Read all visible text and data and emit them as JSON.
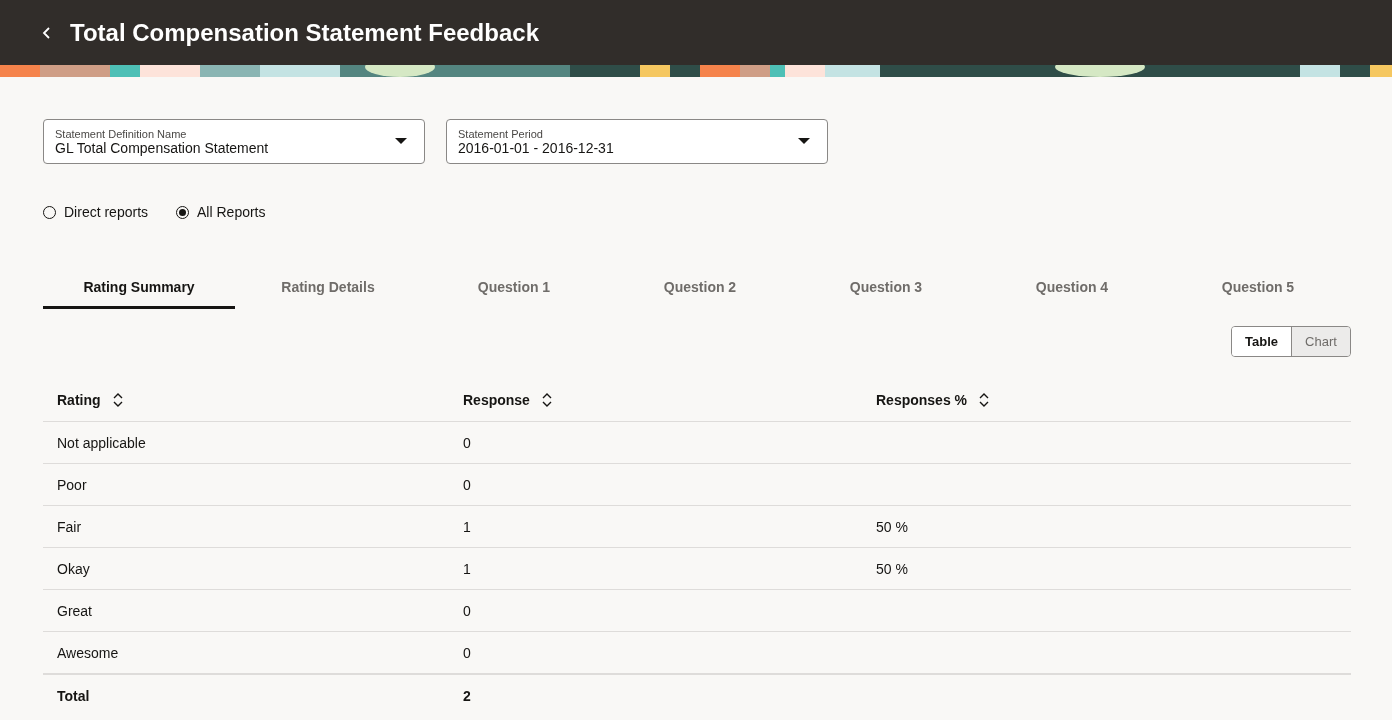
{
  "header": {
    "title": "Total Compensation Statement Feedback"
  },
  "filters": [
    {
      "label": "Statement Definition Name",
      "value": "GL Total Compensation Statement"
    },
    {
      "label": "Statement Period",
      "value": "2016-01-01 - 2016-12-31"
    }
  ],
  "report_scope": [
    {
      "label": "Direct reports",
      "selected": false
    },
    {
      "label": "All Reports",
      "selected": true
    }
  ],
  "tabs": [
    {
      "label": "Rating Summary",
      "selected": true
    },
    {
      "label": "Rating Details",
      "selected": false
    },
    {
      "label": "Question 1",
      "selected": false
    },
    {
      "label": "Question 2",
      "selected": false
    },
    {
      "label": "Question 3",
      "selected": false
    },
    {
      "label": "Question 4",
      "selected": false
    },
    {
      "label": "Question 5",
      "selected": false
    }
  ],
  "view_toggle": [
    {
      "label": "Table",
      "selected": true
    },
    {
      "label": "Chart",
      "selected": false
    }
  ],
  "table": {
    "columns": [
      "Rating",
      "Response",
      "Responses %"
    ],
    "rows": [
      [
        "Not applicable",
        "0",
        ""
      ],
      [
        "Poor",
        "0",
        ""
      ],
      [
        "Fair",
        "1",
        "50 %"
      ],
      [
        "Okay",
        "1",
        "50 %"
      ],
      [
        "Great",
        "0",
        ""
      ],
      [
        "Awesome",
        "0",
        ""
      ]
    ],
    "total": [
      "Total",
      "2"
    ]
  }
}
